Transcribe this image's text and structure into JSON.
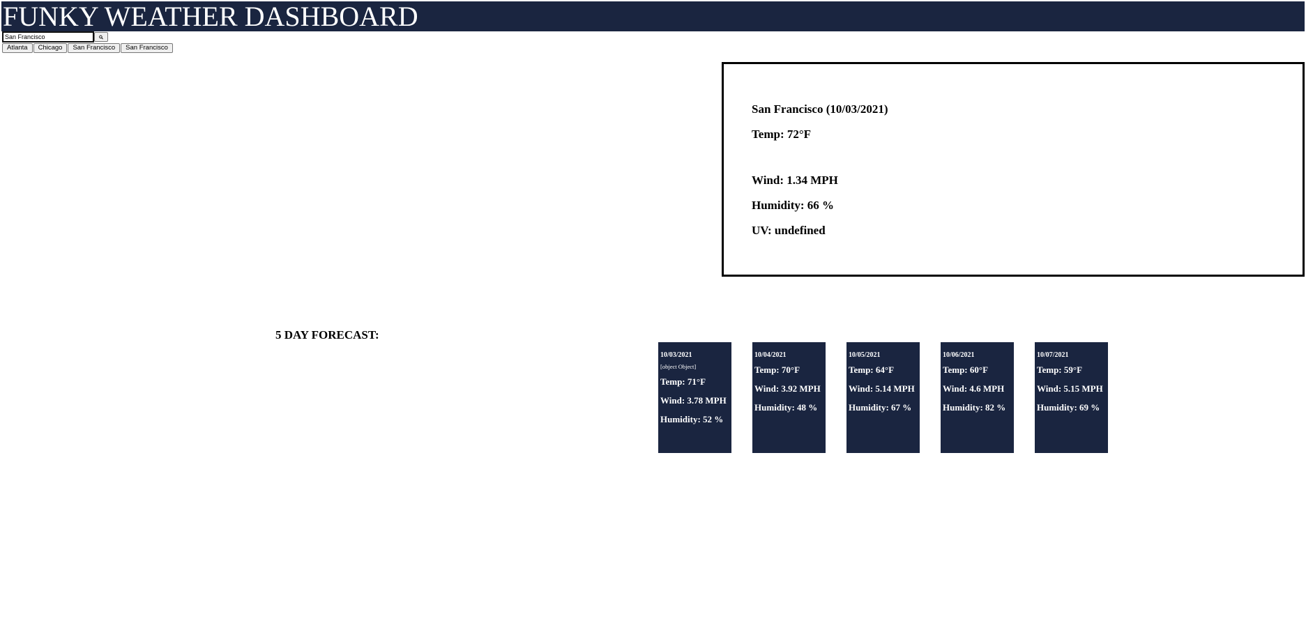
{
  "header": {
    "title": "FUNKY WEATHER DASHBOARD"
  },
  "search": {
    "value": "San Francisco"
  },
  "history": [
    "Atlanta",
    "Chicago",
    "San Francisco",
    "San Francisco"
  ],
  "current": {
    "title": "San Francisco (10/03/2021)",
    "temp": "Temp: 72°F",
    "wind": "Wind: 1.34 MPH",
    "humidity": "Humidity: 66 %",
    "uv": "UV: undefined"
  },
  "forecast": {
    "title": "5 DAY FORECAST:",
    "days": [
      {
        "date": "10/03/2021",
        "icon_text": "[object Object]",
        "temp": "Temp: 71°F",
        "wind": "Wind: 3.78 MPH",
        "humidity": "Humidity: 52 %"
      },
      {
        "date": "10/04/2021",
        "temp": "Temp: 70°F",
        "wind": "Wind: 3.92 MPH",
        "humidity": "Humidity: 48 %"
      },
      {
        "date": "10/05/2021",
        "temp": "Temp: 64°F",
        "wind": "Wind: 5.14 MPH",
        "humidity": "Humidity: 67 %"
      },
      {
        "date": "10/06/2021",
        "temp": "Temp: 60°F",
        "wind": "Wind: 4.6 MPH",
        "humidity": "Humidity: 82 %"
      },
      {
        "date": "10/07/2021",
        "temp": "Temp: 59°F",
        "wind": "Wind: 5.15 MPH",
        "humidity": "Humidity: 69 %"
      }
    ]
  },
  "colors": {
    "header_bg": "#1a2540",
    "card_bg": "#1a2540"
  },
  "icons": {
    "search_button": "search-icon"
  }
}
